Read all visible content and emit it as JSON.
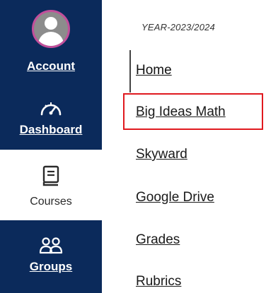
{
  "sidebar": {
    "items": [
      {
        "label": "Account",
        "icon": "account-avatar-icon"
      },
      {
        "label": "Dashboard",
        "icon": "dashboard-gauge-icon"
      },
      {
        "label": "Courses",
        "icon": "courses-book-icon",
        "active": true
      },
      {
        "label": "Groups",
        "icon": "groups-people-icon"
      }
    ]
  },
  "course_nav": {
    "term": "YEAR-2023/2024",
    "links": [
      {
        "label": "Home",
        "active": true
      },
      {
        "label": "Big Ideas Math",
        "highlighted": true
      },
      {
        "label": "Skyward"
      },
      {
        "label": "Google Drive"
      },
      {
        "label": "Grades"
      },
      {
        "label": "Rubrics"
      }
    ]
  },
  "colors": {
    "sidebar_bg": "#0b2a5b",
    "avatar_ring": "#c24f9b",
    "highlight_border": "#e0191f"
  }
}
